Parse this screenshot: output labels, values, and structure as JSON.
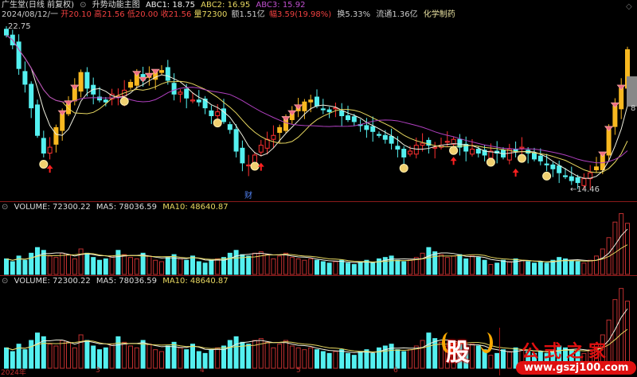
{
  "header": {
    "stock_name": "广生堂(日线 前复权)",
    "indicator_name": "升势动能主图",
    "abc1": "ABC1: 18.75",
    "abc2": "ABC2: 16.95",
    "abc3": "ABC3: 15.92",
    "date": "2024/08/12/一",
    "open": "开20.10",
    "high": "高21.56",
    "low": "低20.00",
    "close": "收21.56",
    "volume": "量72300",
    "amount": "额1.51亿",
    "change": "幅3.59(19.98%)",
    "turnover": "换5.33%",
    "float": "流通1.36亿",
    "sector": "化学制药"
  },
  "labels": {
    "max_price": "22.75",
    "min_price": "←14.46",
    "finance_marker": "财",
    "right_label": "8"
  },
  "volume_panels": [
    {
      "volume": "VOLUME: 72300.22",
      "ma5": "MA5: 78036.59",
      "ma10": "MA10: 48640.87"
    },
    {
      "volume": "VOLUME: 72300.22",
      "ma5": "MA5: 78036.59",
      "ma10": "MA10: 48640.87"
    }
  ],
  "x_axis": [
    "2024年",
    "3",
    "4",
    "5",
    "6"
  ],
  "watermark": {
    "logo": "股",
    "title": "公式之家",
    "url": "www.gszj100.com"
  },
  "colors": {
    "up": "#ff3030",
    "down": "#54f0f0",
    "gold": "#f8b820",
    "ma5": "#f0f0e0",
    "ma10": "#e8d860",
    "ma20": "#b040c0"
  },
  "chart_data": {
    "type": "candlestick",
    "ylim": [
      14.46,
      22.75
    ],
    "close": [
      22.3,
      21.8,
      20.6,
      19.8,
      18.6,
      17.2,
      16.3,
      16.6,
      17.6,
      18.3,
      18.8,
      19.6,
      20.4,
      19.6,
      19.3,
      19.0,
      18.9,
      19.3,
      19.2,
      19.5,
      19.9,
      20.3,
      20.0,
      20.2,
      20.4,
      20.5,
      20.0,
      19.3,
      19.4,
      19.1,
      19.0,
      18.9,
      18.6,
      18.2,
      18.4,
      17.9,
      17.5,
      16.4,
      15.8,
      15.7,
      16.2,
      16.7,
      17.0,
      17.2,
      17.6,
      18.0,
      18.3,
      18.6,
      18.9,
      19.0,
      18.7,
      18.5,
      18.4,
      18.6,
      18.2,
      18.0,
      17.9,
      17.7,
      17.5,
      17.4,
      17.2,
      17.0,
      16.8,
      16.5,
      16.1,
      16.4,
      16.7,
      16.8,
      16.7,
      16.6,
      16.7,
      16.9,
      17.0,
      16.6,
      16.4,
      16.5,
      16.3,
      16.2,
      16.4,
      16.3,
      16.1,
      16.5,
      16.4,
      16.6,
      16.3,
      16.0,
      15.9,
      15.7,
      15.5,
      15.3,
      15.1,
      14.9,
      14.8,
      15.0,
      15.3,
      15.6,
      16.2,
      17.5,
      18.7,
      19.6,
      21.56
    ],
    "volume": [
      22000,
      18000,
      26000,
      20000,
      30000,
      38000,
      34000,
      26000,
      24000,
      30000,
      28000,
      22000,
      36000,
      30000,
      24000,
      20000,
      22000,
      26000,
      34000,
      28000,
      24000,
      22000,
      30000,
      26000,
      20000,
      18000,
      24000,
      28000,
      22000,
      20000,
      26000,
      18000,
      16000,
      20000,
      22000,
      24000,
      30000,
      34000,
      28000,
      26000,
      30000,
      32000,
      28000,
      22000,
      26000,
      30000,
      24000,
      22000,
      20000,
      22000,
      20000,
      18000,
      16000,
      18000,
      20000,
      16000,
      14000,
      18000,
      20000,
      16000,
      22000,
      24000,
      26000,
      20000,
      18000,
      20000,
      24000,
      30000,
      38000,
      32000,
      28000,
      24000,
      26000,
      28000,
      22000,
      26000,
      24000,
      20000,
      14000,
      16000,
      20000,
      18000,
      22000,
      20000,
      18000,
      16000,
      18000,
      16000,
      20000,
      24000,
      22000,
      20000,
      18000,
      16000,
      20000,
      26000,
      36000,
      52000,
      74000,
      86000,
      72300
    ]
  }
}
